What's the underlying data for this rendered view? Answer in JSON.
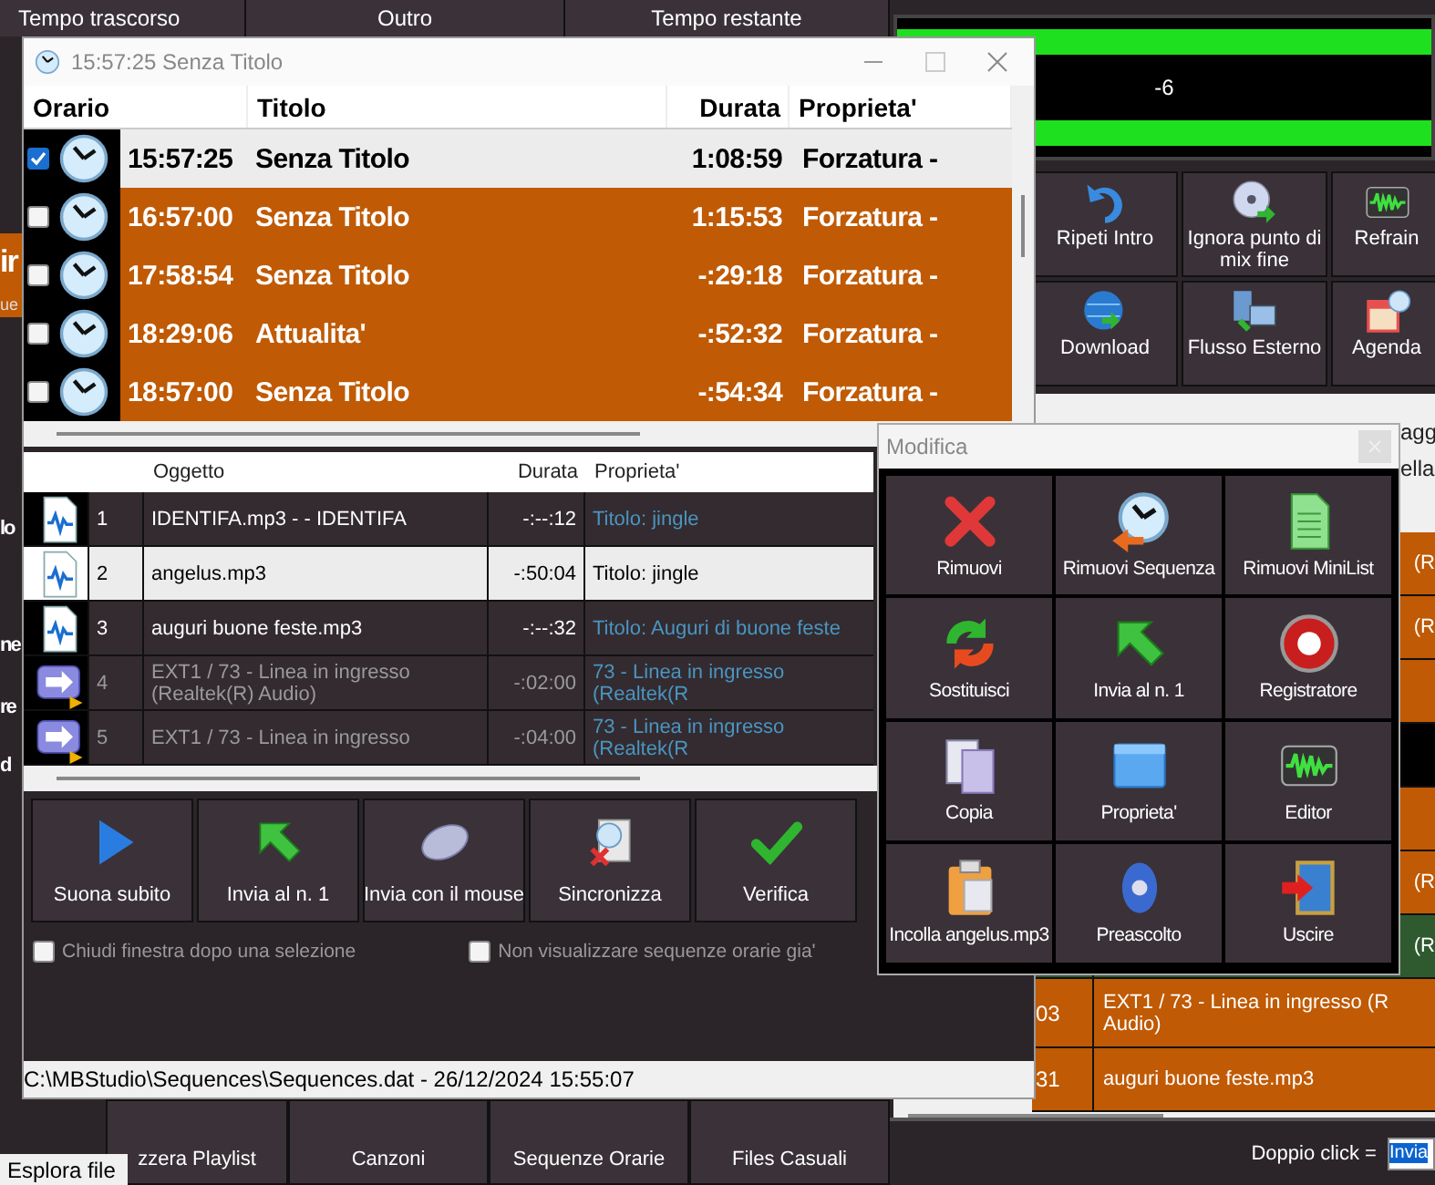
{
  "header_cells": [
    {
      "label": "Tempo trascorso"
    },
    {
      "label": "Outro"
    },
    {
      "label": "Tempo restante"
    }
  ],
  "side_fragments": [
    "ir",
    "ue",
    "lo",
    "ne",
    "re",
    "d"
  ],
  "meter": {
    "reading": "-6"
  },
  "tool_buttons": [
    {
      "label": "Ripeti Intro"
    },
    {
      "label": "Ignora punto di mix fine"
    },
    {
      "label": "Refrain"
    },
    {
      "label": "Download"
    },
    {
      "label": "Flusso Esterno"
    },
    {
      "label": "Agenda"
    }
  ],
  "playlist": {
    "header_fragments": [
      "agg",
      "ella"
    ],
    "rows": [
      {
        "lines": [
          "(R"
        ],
        "color": "#c05a04"
      },
      {
        "lines": [
          "(R"
        ],
        "color": "#c05a04"
      },
      {
        "color": "#c05a04"
      },
      {
        "color": "#000000"
      },
      {
        "color": "#c05a04"
      },
      {
        "lines": [
          "(R"
        ],
        "color": "#c05a04"
      },
      {
        "lines": [
          "(R"
        ],
        "color": "#2f5a30"
      },
      {
        "number": "03",
        "lines": [
          "EXT1 / 73 - Linea in ingresso (R",
          "Audio)"
        ],
        "color": "#c05a04"
      },
      {
        "number": "31",
        "lines": [
          "auguri buone feste.mp3"
        ],
        "color": "#c05a04"
      }
    ]
  },
  "double_click": {
    "label": "Doppio click =",
    "value": "Invia"
  },
  "bottom_buttons": [
    {
      "label": "zzera Playlist"
    },
    {
      "label": "Canzoni"
    },
    {
      "label": "Sequenze Orarie"
    },
    {
      "label": "Files Casuali"
    }
  ],
  "tooltip": "Esplora file",
  "sequences_window": {
    "title": "15:57:25 Senza Titolo",
    "columns": [
      "Orario",
      "Titolo",
      "Durata",
      "Proprieta'"
    ],
    "rows": [
      {
        "checked": true,
        "selected": true,
        "time": "15:57:25",
        "title": "Senza Titolo",
        "duration": "1:08:59",
        "property": "Forzatura -"
      },
      {
        "checked": false,
        "selected": false,
        "time": "16:57:00",
        "title": "Senza Titolo",
        "duration": "1:15:53",
        "property": "Forzatura -"
      },
      {
        "checked": false,
        "selected": false,
        "time": "17:58:54",
        "title": "Senza Titolo",
        "duration": "-:29:18",
        "property": "Forzatura -"
      },
      {
        "checked": false,
        "selected": false,
        "time": "18:29:06",
        "title": "Attualita'",
        "duration": "-:52:32",
        "property": "Forzatura -"
      },
      {
        "checked": false,
        "selected": false,
        "time": "18:57:00",
        "title": "Senza Titolo",
        "duration": "-:54:34",
        "property": "Forzatura -"
      }
    ],
    "items": {
      "columns": [
        "Oggetto",
        "Durata",
        "Proprieta'"
      ],
      "rows": [
        {
          "kind": "file",
          "selected": false,
          "number": "1",
          "object": "IDENTIFA.mp3 - - IDENTIFA",
          "duration": "-:--:12",
          "property": "Titolo: jingle"
        },
        {
          "kind": "file",
          "selected": true,
          "number": "2",
          "object": "angelus.mp3",
          "duration": "-:50:04",
          "property": "Titolo: jingle"
        },
        {
          "kind": "file",
          "selected": false,
          "number": "3",
          "object": "auguri buone feste.mp3",
          "duration": "-:--:32",
          "property": "Titolo: Auguri di buone feste"
        },
        {
          "kind": "stream",
          "selected": false,
          "number": "4",
          "object": "EXT1 / 73 - Linea in ingresso (Realtek(R) Audio)",
          "duration": "-:02:00",
          "property": "73 - Linea in ingresso (Realtek(R"
        },
        {
          "kind": "stream",
          "selected": false,
          "number": "5",
          "object": "EXT1 / 73 - Linea in ingresso",
          "duration": "-:04:00",
          "property": "73 - Linea in ingresso (Realtek(R"
        }
      ]
    },
    "actions": [
      {
        "label": "Suona subito"
      },
      {
        "label": "Invia al n. 1"
      },
      {
        "label": "Invia con il mouse"
      },
      {
        "label": "Sincronizza"
      },
      {
        "label": "Verifica"
      }
    ],
    "options": [
      {
        "label": "Chiudi finestra dopo una selezione",
        "checked": false
      },
      {
        "label": "Non visualizzare sequenze orarie gia'",
        "checked": false
      }
    ],
    "status": "C:\\MBStudio\\Sequences\\Sequences.dat - 26/12/2024 15:55:07"
  },
  "edit_window": {
    "title": "Modifica",
    "buttons": [
      {
        "label": "Rimuovi"
      },
      {
        "label": "Rimuovi Sequenza"
      },
      {
        "label": "Rimuovi MiniList"
      },
      {
        "label": "Sostituisci"
      },
      {
        "label": "Invia al n. 1"
      },
      {
        "label": "Registratore"
      },
      {
        "label": "Copia"
      },
      {
        "label": "Proprieta'"
      },
      {
        "label": "Editor"
      },
      {
        "label": "Incolla angelus.mp3"
      },
      {
        "label": "Preascolto"
      },
      {
        "label": "Uscire"
      }
    ]
  }
}
